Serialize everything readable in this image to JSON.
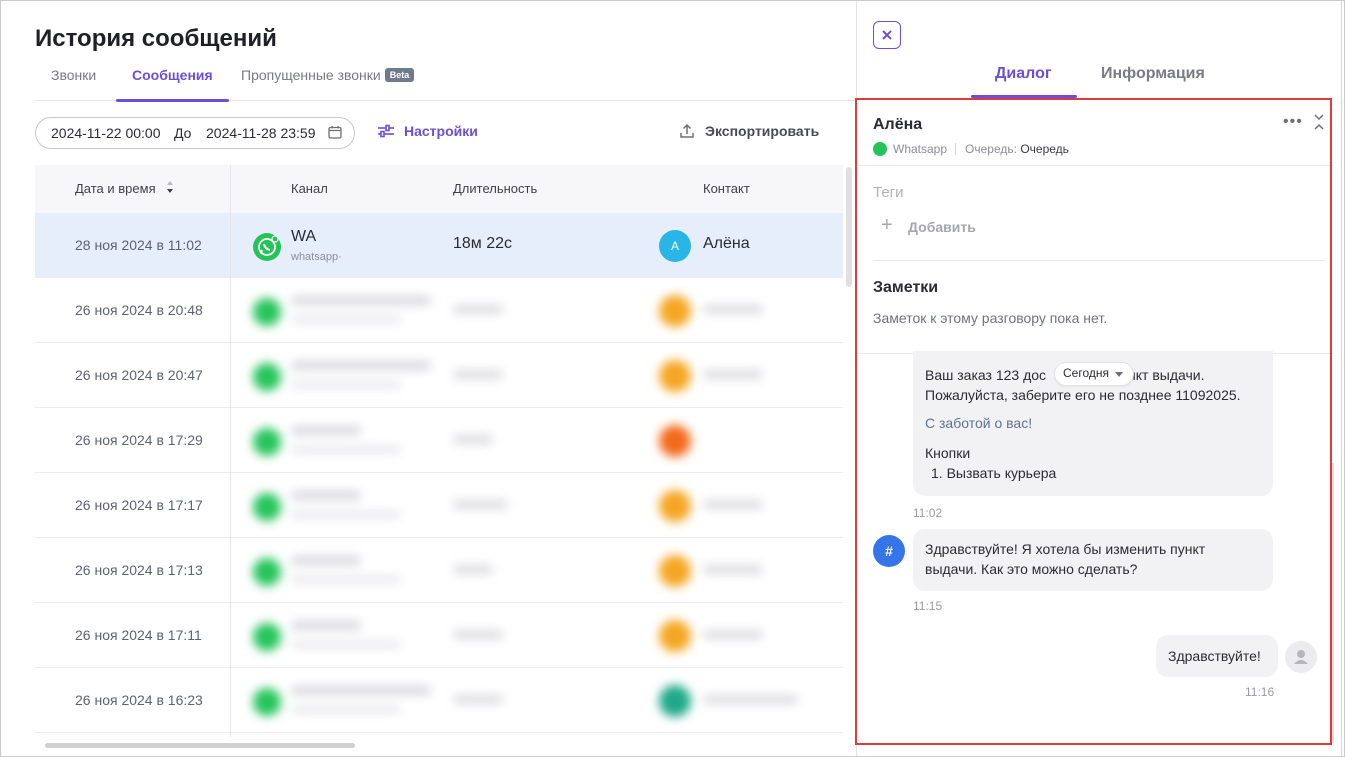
{
  "page": {
    "title": "История сообщений",
    "tabs": [
      {
        "label": "Звонки",
        "active": false
      },
      {
        "label": "Сообщения",
        "active": true
      },
      {
        "label": "Пропущенные звонки",
        "badge": "Beta",
        "active": false
      }
    ]
  },
  "filters": {
    "date_from": "2024-11-22 00:00",
    "to_label": "До",
    "date_to": "2024-11-28 23:59",
    "settings_label": "Настройки",
    "export_label": "Экспортировать"
  },
  "table": {
    "columns": [
      "Дата и время",
      "Канал",
      "Длительность",
      "Контакт"
    ],
    "rows": [
      {
        "date": "28 ноя 2024 в 11:02",
        "channel": "WA",
        "channel_sub": "whatsapp·",
        "duration": "18м 22с",
        "avatar_letter": "А",
        "avatar_color": "#29b6e6",
        "contact": "Алёна",
        "selected": true
      },
      {
        "date": "26 ноя 2024 в 20:48",
        "avatar_color": "#f5a623",
        "blurred": true
      },
      {
        "date": "26 ноя 2024 в 20:47",
        "avatar_color": "#f5a623",
        "blurred": true
      },
      {
        "date": "26 ноя 2024 в 17:29",
        "avatar_color": "#f26a1b",
        "blurred": true
      },
      {
        "date": "26 ноя 2024 в 17:17",
        "avatar_color": "#f5a623",
        "blurred": true
      },
      {
        "date": "26 ноя 2024 в 17:13",
        "avatar_color": "#f5a623",
        "blurred": true
      },
      {
        "date": "26 ноя 2024 в 17:11",
        "avatar_color": "#f5a623",
        "blurred": true
      },
      {
        "date": "26 ноя 2024 в 16:23",
        "avatar_color": "#1fa889",
        "blurred": true
      }
    ]
  },
  "panel": {
    "tabs": [
      {
        "label": "Диалог",
        "active": true
      },
      {
        "label": "Информация",
        "active": false
      }
    ],
    "contact_name": "Алёна",
    "channel": "Whatsapp",
    "queue_label": "Очередь:",
    "queue_value": "Очередь",
    "tags_title": "Теги",
    "add_tag_label": "Добавить",
    "notes_title": "Заметки",
    "notes_empty": "Заметок к этому разговору пока нет.",
    "date_chip": "Сегодня",
    "messages": [
      {
        "line1": "Ваш заказ 123 дос",
        "line1_tail": "нкт выдачи.",
        "line2": "Пожалуйста, заберите его не позднее 11092025.",
        "signature": "С заботой о вас!",
        "buttons_title": "Кнопки",
        "button_1": "1. Вызвать курьера",
        "time": "11:02"
      },
      {
        "avatar": "#",
        "text1": "Здравствуйте! Я хотела бы изменить пункт",
        "text2": "выдачи. Как это можно сделать?",
        "time": "11:15"
      },
      {
        "text": "Здравствуйте!",
        "time": "11:16"
      }
    ]
  },
  "colors": {
    "accent": "#6b4fd8",
    "whatsapp": "#25c45a",
    "highlight_border": "#e03a3a",
    "selected_row": "#e6eefb"
  }
}
